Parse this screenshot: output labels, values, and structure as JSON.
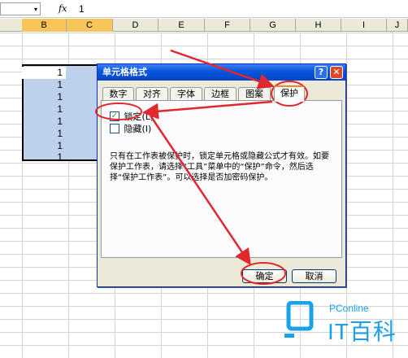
{
  "formula_bar": {
    "name_box_value": "",
    "dropdown_glyph": "▾",
    "fx_label": "fx",
    "value": "1"
  },
  "columns": [
    "B",
    "C",
    "D",
    "E",
    "F",
    "G",
    "H",
    "I",
    "J"
  ],
  "cell_values": [
    "1",
    "1",
    "1",
    "1",
    "1",
    "1",
    "1",
    "1"
  ],
  "dialog": {
    "title": "单元格格式",
    "help_label": "?",
    "close_label": "✕",
    "tabs": [
      "数字",
      "对齐",
      "字体",
      "边框",
      "图案",
      "保护"
    ],
    "active_tab": "保护",
    "lock_label": "锁定(L)",
    "lock_checked": true,
    "hide_label": "隐藏(I)",
    "hide_checked": false,
    "description": "只有在工作表被保护时，锁定单元格或隐藏公式才有效。如要保护工作表，请选择“工具”菜单中的“保护”命令，然后选择“保护工作表”。可以选择是否加密码保护。",
    "ok_label": "确定",
    "cancel_label": "取消"
  },
  "watermark": {
    "brand": "PConline",
    "name": "IT百科"
  },
  "colors": {
    "selection": "#bdd0ec",
    "annotation": "#e0282e",
    "titlebar": "#0a58dc",
    "watermark": "#1aa2e8"
  }
}
